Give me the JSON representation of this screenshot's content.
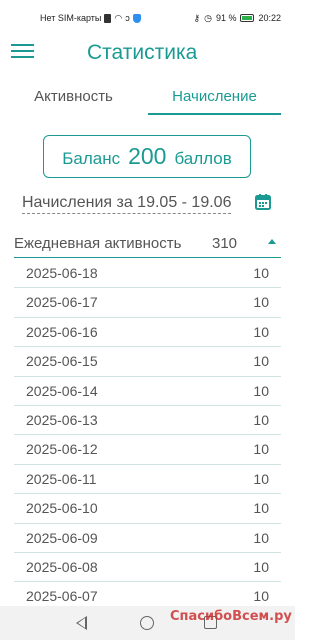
{
  "status_bar": {
    "carrier": "Нет SIM-карты",
    "battery_percent": "91 %",
    "time": "20:22",
    "icons": [
      "sim-icon",
      "wifi-icon",
      "nfc-icon",
      "shield-icon",
      "key-icon",
      "alarm-icon",
      "battery-icon"
    ]
  },
  "app_bar": {
    "title": "Статистика",
    "menu_icon": "hamburger-menu-icon"
  },
  "tabs": [
    {
      "label": "Активность",
      "active": false
    },
    {
      "label": "Начисление",
      "active": true
    }
  ],
  "balance": {
    "label": "Баланс",
    "value": "200",
    "unit": "баллов"
  },
  "period": {
    "text": "Начисления за 19.05 - 19.06",
    "icon": "calendar-icon"
  },
  "daily": {
    "label": "Ежедневная активность",
    "total": "310",
    "sort_icon": "sort-up-icon"
  },
  "rows": [
    {
      "date": "2025-06-18",
      "value": "10"
    },
    {
      "date": "2025-06-17",
      "value": "10"
    },
    {
      "date": "2025-06-16",
      "value": "10"
    },
    {
      "date": "2025-06-15",
      "value": "10"
    },
    {
      "date": "2025-06-14",
      "value": "10"
    },
    {
      "date": "2025-06-13",
      "value": "10"
    },
    {
      "date": "2025-06-12",
      "value": "10"
    },
    {
      "date": "2025-06-11",
      "value": "10"
    },
    {
      "date": "2025-06-10",
      "value": "10"
    },
    {
      "date": "2025-06-09",
      "value": "10"
    },
    {
      "date": "2025-06-08",
      "value": "10"
    },
    {
      "date": "2025-06-07",
      "value": "10"
    }
  ],
  "nav_bar": {
    "icons": [
      "back-icon",
      "home-icon",
      "recent-apps-icon"
    ]
  },
  "watermark": "СпасибоВсем.ру",
  "colors": {
    "accent": "#1a9a93",
    "text": "#555555",
    "divider": "#cfe3e2"
  }
}
